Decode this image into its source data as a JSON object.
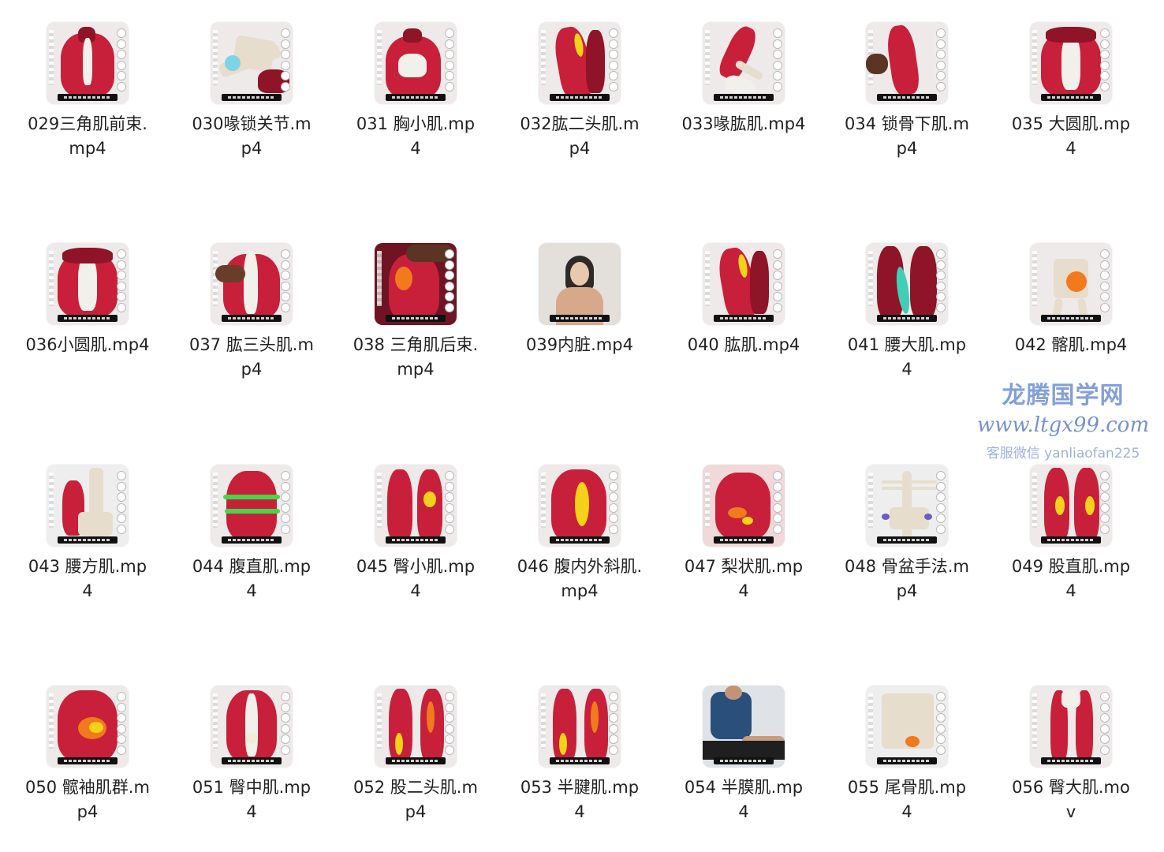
{
  "files": [
    {
      "name": "029三角肌前束.\nmp4",
      "thumb": "anatomy-shoulder"
    },
    {
      "name": "030喙锁关节.m\np4",
      "thumb": "anatomy-joint"
    },
    {
      "name": "031 胸小肌.mp\n4",
      "thumb": "anatomy-chest"
    },
    {
      "name": "032肱二头肌.m\np4",
      "thumb": "anatomy-arm"
    },
    {
      "name": "033喙肱肌.mp4",
      "thumb": "anatomy-arm-bone"
    },
    {
      "name": "034 锁骨下肌.m\np4",
      "thumb": "anatomy-arm-hand"
    },
    {
      "name": "035 大圆肌.mp\n4",
      "thumb": "anatomy-back"
    },
    {
      "name": "036小圆肌.mp4",
      "thumb": "anatomy-back"
    },
    {
      "name": "037 肱三头肌.m\np4",
      "thumb": "anatomy-back-hand"
    },
    {
      "name": "038 三角肌后束.\nmp4",
      "thumb": "anatomy-deltoid"
    },
    {
      "name": "039内脏.mp4",
      "thumb": "photo-woman"
    },
    {
      "name": "040 肱肌.mp4",
      "thumb": "anatomy-arm"
    },
    {
      "name": "041 腰大肌.mp\n4",
      "thumb": "anatomy-psoas"
    },
    {
      "name": "042 髂肌.mp4",
      "thumb": "anatomy-pelvis"
    },
    {
      "name": "043 腰方肌.mp\n4",
      "thumb": "anatomy-spine"
    },
    {
      "name": "044 腹直肌.mp\n4",
      "thumb": "anatomy-abs"
    },
    {
      "name": "045 臀小肌.mp\n4",
      "thumb": "anatomy-glute"
    },
    {
      "name": "046 腹内外斜肌.\nmp4",
      "thumb": "anatomy-oblique"
    },
    {
      "name": "047 梨状肌.mp\n4",
      "thumb": "anatomy-piriformis"
    },
    {
      "name": "048 骨盆手法.m\np4",
      "thumb": "anatomy-skeleton"
    },
    {
      "name": "049 股直肌.mp\n4",
      "thumb": "anatomy-thigh"
    },
    {
      "name": "050 髋袖肌群.m\np4",
      "thumb": "anatomy-hip"
    },
    {
      "name": "051 臀中肌.mp\n4",
      "thumb": "anatomy-glute-back"
    },
    {
      "name": "052 股二头肌.m\np4",
      "thumb": "anatomy-hamstring"
    },
    {
      "name": "053 半腱肌.mp\n4",
      "thumb": "anatomy-hamstring"
    },
    {
      "name": "054 半膜肌.mp\n4",
      "thumb": "photo-therapist"
    },
    {
      "name": "055 尾骨肌.mp\n4",
      "thumb": "anatomy-sacrum"
    },
    {
      "name": "056 臀大肌.mo\nv",
      "thumb": "anatomy-legs"
    }
  ],
  "watermark": {
    "line1": "龙腾国学网",
    "line2": "www.ltgx99.com",
    "line3": "客服微信 yanliaofan225"
  },
  "colors": {
    "muscle": "#c8203a",
    "muscle_dark": "#8f1428",
    "tendon": "#f2f0ea",
    "highlight_yellow": "#f5d21a",
    "highlight_orange": "#f07a1c",
    "highlight_teal": "#3fcfb7",
    "highlight_green": "#45d64a",
    "watermark": "#6f8fd4"
  }
}
